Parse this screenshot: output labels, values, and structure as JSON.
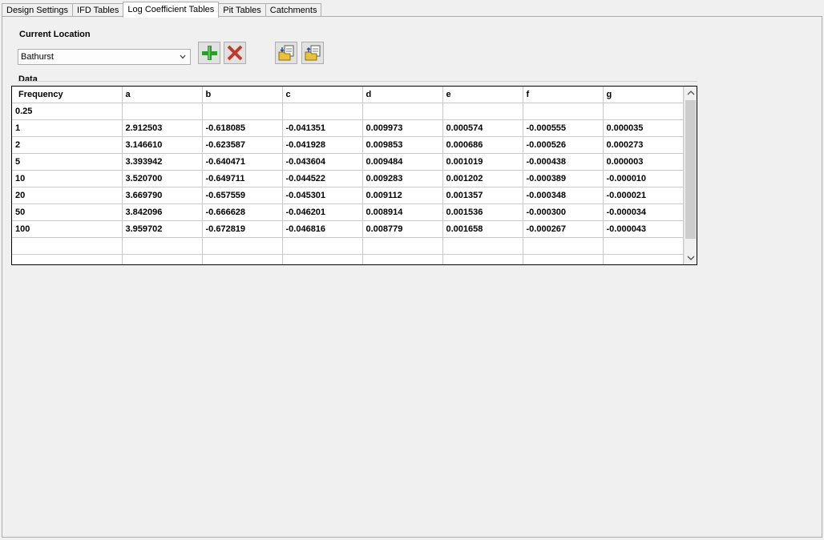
{
  "tabs": [
    {
      "label": "Design Settings",
      "active": false
    },
    {
      "label": "IFD Tables",
      "active": false
    },
    {
      "label": "Log Coefficient Tables",
      "active": true
    },
    {
      "label": "Pit Tables",
      "active": false
    },
    {
      "label": "Catchments",
      "active": false
    }
  ],
  "location": {
    "label": "Current Location",
    "selected": "Bathurst"
  },
  "data_section": {
    "label": "Data"
  },
  "table": {
    "columns": [
      "Frequency",
      "a",
      "b",
      "c",
      "d",
      "e",
      "f",
      "g"
    ],
    "rows": [
      [
        "0.25",
        "",
        "",
        "",
        "",
        "",
        "",
        ""
      ],
      [
        "1",
        "2.912503",
        "-0.618085",
        "-0.041351",
        "0.009973",
        "0.000574",
        "-0.000555",
        "0.000035"
      ],
      [
        "2",
        "3.146610",
        "-0.623587",
        "-0.041928",
        "0.009853",
        "0.000686",
        "-0.000526",
        "0.000273"
      ],
      [
        "5",
        "3.393942",
        "-0.640471",
        "-0.043604",
        "0.009484",
        "0.001019",
        "-0.000438",
        "0.000003"
      ],
      [
        "10",
        "3.520700",
        "-0.649711",
        "-0.044522",
        "0.009283",
        "0.001202",
        "-0.000389",
        "-0.000010"
      ],
      [
        "20",
        "3.669790",
        "-0.657559",
        "-0.045301",
        "0.009112",
        "0.001357",
        "-0.000348",
        "-0.000021"
      ],
      [
        "50",
        "3.842096",
        "-0.666628",
        "-0.046201",
        "0.008914",
        "0.001536",
        "-0.000300",
        "-0.000034"
      ],
      [
        "100",
        "3.959702",
        "-0.672819",
        "-0.046816",
        "0.008779",
        "0.001658",
        "-0.000267",
        "-0.000043"
      ],
      [
        "",
        "",
        "",
        "",
        "",
        "",
        "",
        ""
      ],
      [
        "",
        "",
        "",
        "",
        "",
        "",
        "",
        ""
      ]
    ]
  },
  "icons": {
    "add": "plus-icon",
    "delete": "cross-icon",
    "import": "import-folder-icon",
    "export": "export-folder-icon"
  },
  "colors": {
    "add_green": "#2e9a2e",
    "delete_red": "#c0392b",
    "folder_yellow": "#e8c23a"
  }
}
